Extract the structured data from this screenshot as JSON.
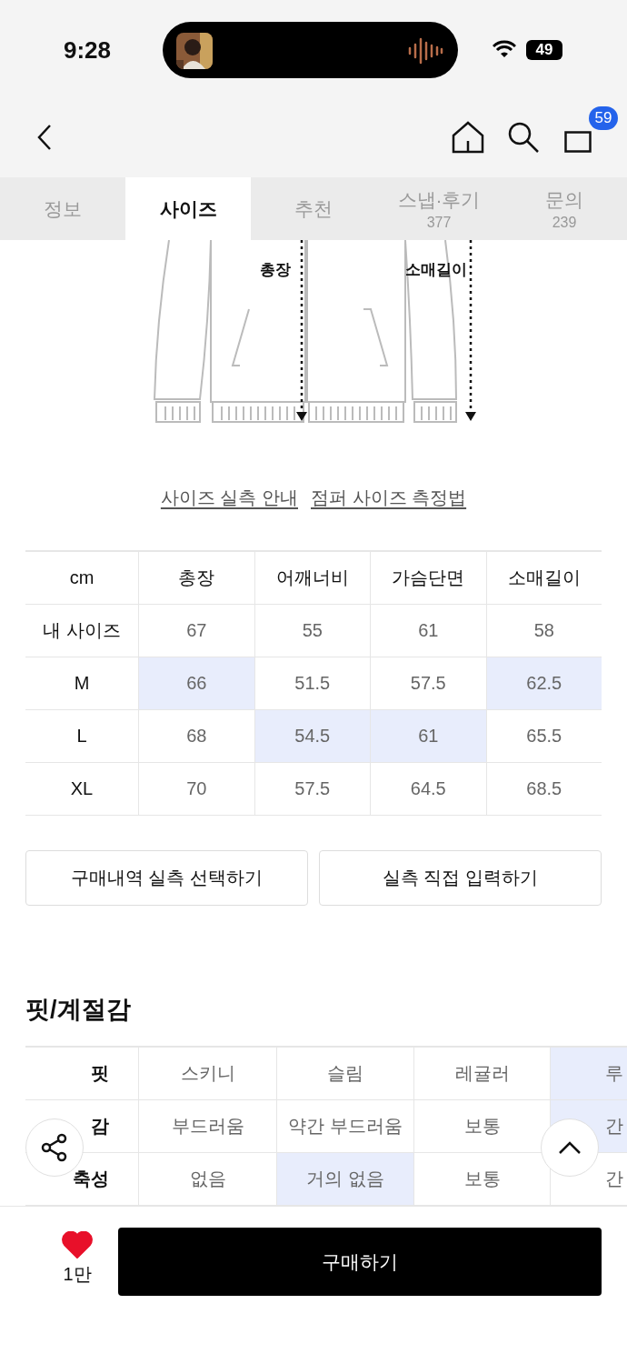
{
  "status_bar": {
    "time": "9:28",
    "battery": "49"
  },
  "nav": {
    "cart_count": "59"
  },
  "tabs": [
    {
      "label": "정보",
      "selected": false
    },
    {
      "label": "사이즈",
      "selected": true
    },
    {
      "label": "추천",
      "selected": false
    },
    {
      "label": "스냅·후기",
      "count": "377",
      "selected": false
    },
    {
      "label": "문의",
      "count": "239",
      "selected": false
    }
  ],
  "diagram": {
    "labels": [
      "총장",
      "소매길이"
    ]
  },
  "links": [
    "사이즈 실측 안내",
    "점퍼 사이즈 측정법"
  ],
  "size_table": {
    "columns": [
      "cm",
      "총장",
      "어깨너비",
      "가슴단면",
      "소매길이"
    ],
    "rows": [
      {
        "cells": [
          {
            "text": "내 사이즈",
            "highlighted": false
          },
          {
            "text": "67",
            "highlighted": false
          },
          {
            "text": "55",
            "highlighted": false
          },
          {
            "text": "61",
            "highlighted": false
          },
          {
            "text": "58",
            "highlighted": false
          }
        ]
      },
      {
        "cells": [
          {
            "text": "M",
            "highlighted": false
          },
          {
            "text": "66",
            "highlighted": true
          },
          {
            "text": "51.5",
            "highlighted": false
          },
          {
            "text": "57.5",
            "highlighted": false
          },
          {
            "text": "62.5",
            "highlighted": true
          }
        ]
      },
      {
        "cells": [
          {
            "text": "L",
            "highlighted": false
          },
          {
            "text": "68",
            "highlighted": false
          },
          {
            "text": "54.5",
            "highlighted": true
          },
          {
            "text": "61",
            "highlighted": true
          },
          {
            "text": "65.5",
            "highlighted": false
          }
        ]
      },
      {
        "cells": [
          {
            "text": "XL",
            "highlighted": false
          },
          {
            "text": "70",
            "highlighted": false
          },
          {
            "text": "57.5",
            "highlighted": false
          },
          {
            "text": "64.5",
            "highlighted": false
          },
          {
            "text": "68.5",
            "highlighted": false
          }
        ]
      }
    ]
  },
  "size_buttons": [
    "구매내역 실측 선택하기",
    "실측 직접 입력하기"
  ],
  "fit_section": {
    "title": "핏/계절감",
    "rows": [
      {
        "label": "핏",
        "options": [
          {
            "text": "스키니",
            "selected": false
          },
          {
            "text": "슬림",
            "selected": false
          },
          {
            "text": "레귤러",
            "selected": false
          },
          {
            "text": "루",
            "selected": true
          }
        ]
      },
      {
        "label": "감",
        "options": [
          {
            "text": "부드러움",
            "selected": false
          },
          {
            "text": "약간 부드러움",
            "selected": false
          },
          {
            "text": "보통",
            "selected": false
          },
          {
            "text": "간",
            "selected": true
          }
        ]
      },
      {
        "label": "축성",
        "options": [
          {
            "text": "없음",
            "selected": false
          },
          {
            "text": "거의 없음",
            "selected": true
          },
          {
            "text": "보통",
            "selected": false
          },
          {
            "text": "간",
            "selected": false
          }
        ]
      }
    ]
  },
  "bottom_bar": {
    "likes": "1만",
    "liked": true,
    "buy_label": "구매하기"
  }
}
